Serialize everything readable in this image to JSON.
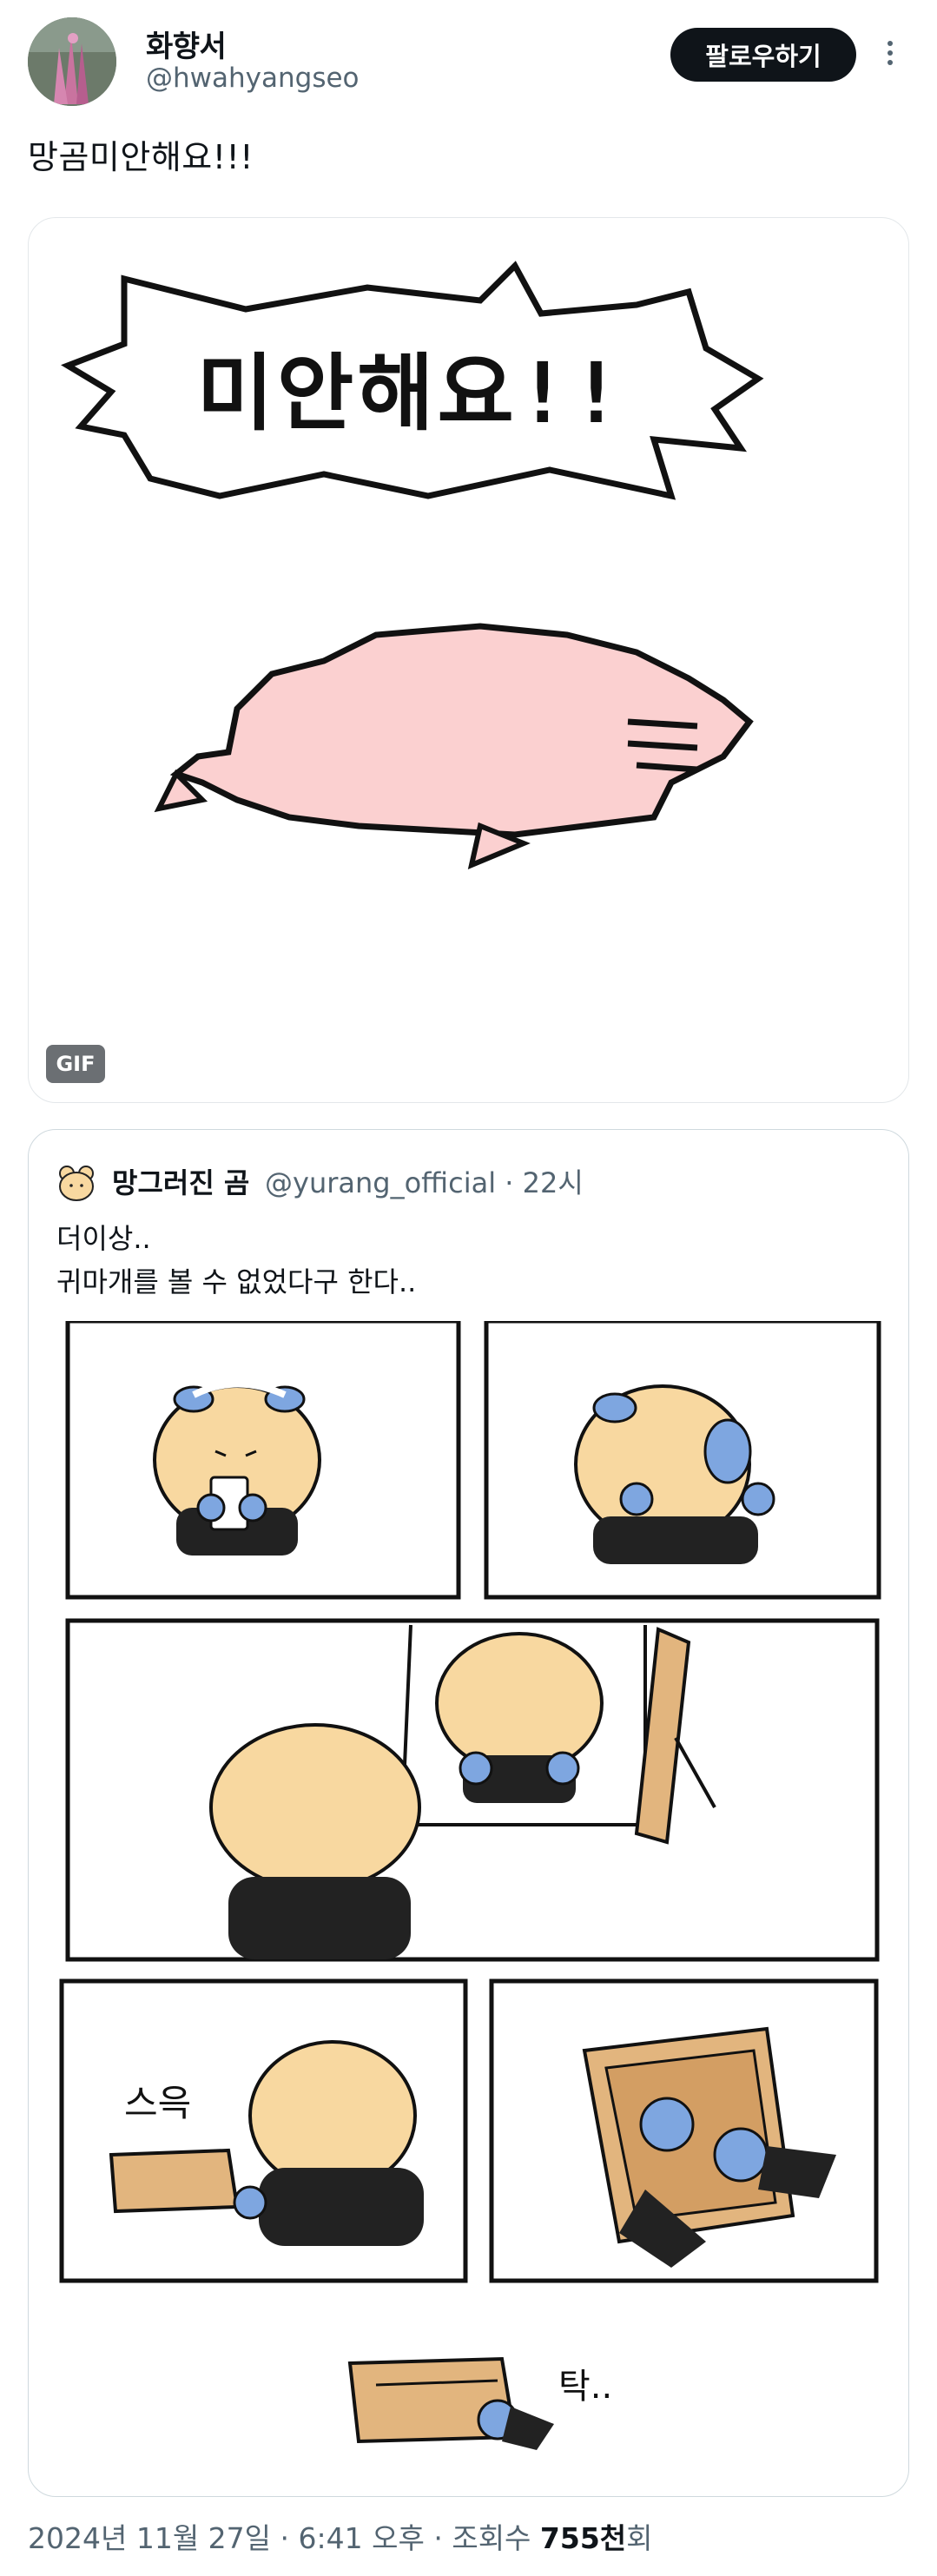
{
  "author": {
    "name": "화향서",
    "handle": "@hwahyangseo",
    "follow_label": "팔로우하기",
    "avatar_icon": "avatar-flower-photo",
    "more_icon": "more-vertical-icon"
  },
  "tweet": {
    "text": "망곰미안해요!!!"
  },
  "media": {
    "speech_text": "미안해요!!",
    "badge": "GIF",
    "bg": "#ffffff",
    "blob_color": "#fbd0d0"
  },
  "quote": {
    "name": "망그러진 곰",
    "handle": "@yurang_official",
    "time": "22시",
    "line1": "더이상..",
    "line2": "귀마개를 볼 수 없었다구 한다..",
    "sfx_1": "스윽",
    "sfx_2": "탁..",
    "bear_color": "#f8d8a0",
    "earmuff_color": "#7ea6e0",
    "box_color": "#e2b57e"
  },
  "footer": {
    "date": "2024년 11월 27일",
    "time": "6:41 오후",
    "views_label": "조회수",
    "views_value": "755천",
    "views_suffix": "회"
  }
}
